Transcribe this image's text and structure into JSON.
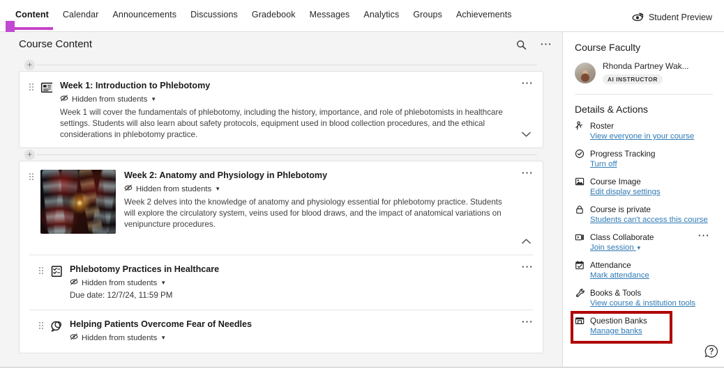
{
  "topnav": {
    "tabs": [
      {
        "label": "Content",
        "active": true
      },
      {
        "label": "Calendar",
        "active": false
      },
      {
        "label": "Announcements",
        "active": false
      },
      {
        "label": "Discussions",
        "active": false
      },
      {
        "label": "Gradebook",
        "active": false
      },
      {
        "label": "Messages",
        "active": false
      },
      {
        "label": "Analytics",
        "active": false
      },
      {
        "label": "Groups",
        "active": false
      },
      {
        "label": "Achievements",
        "active": false
      }
    ],
    "student_preview": "Student Preview",
    "accent_color": "#c644c6"
  },
  "main": {
    "title": "Course Content",
    "search_icon": "search-icon",
    "options_icon": "more-options-icon",
    "add_label": "+",
    "items": [
      {
        "icon": "module-document-icon",
        "title": "Week 1: Introduction to Phlebotomy",
        "visibility": "Hidden from students",
        "description": "Week 1 will cover the fundamentals of phlebotomy, including the history, importance, and role of phlebotomists in healthcare settings. Students will also learn about safety protocols, equipment used in blood collection procedures, and the ethical considerations in phlebotomy practice.",
        "chevron": "chevron-down",
        "thumbnail": false,
        "due": ""
      },
      {
        "icon": "module-document-icon",
        "title": "Week 2: Anatomy and Physiology in Phlebotomy",
        "visibility": "Hidden from students",
        "description": "Week 2 delves into the knowledge of anatomy and physiology essential for phlebotomy practice. Students will explore the circulatory system, veins used for blood draws, and the impact of anatomical variations on venipuncture procedures.",
        "chevron": "chevron-up",
        "thumbnail": true,
        "due": ""
      },
      {
        "icon": "test-assessment-icon",
        "title": "Phlebotomy Practices in Healthcare",
        "visibility": "Hidden from students",
        "description": "",
        "chevron": "",
        "thumbnail": false,
        "due": "Due date: 12/7/24, 11:59 PM"
      },
      {
        "icon": "discussion-icon",
        "title": "Helping Patients Overcome Fear of Needles",
        "visibility": "Hidden from students",
        "description": "",
        "chevron": "",
        "thumbnail": false,
        "due": ""
      }
    ]
  },
  "sidebar": {
    "faculty_title": "Course Faculty",
    "faculty": {
      "name": "Rhonda Partney Wak...",
      "badge": "AI INSTRUCTOR"
    },
    "details_title": "Details & Actions",
    "items": [
      {
        "icon": "roster-person-icon",
        "label": "Roster",
        "link": "View everyone in your course",
        "caret": false,
        "dots": false,
        "highlight": false
      },
      {
        "icon": "progress-check-icon",
        "label": "Progress Tracking",
        "link": "Turn off",
        "caret": false,
        "dots": false,
        "highlight": false
      },
      {
        "icon": "course-image-icon",
        "label": "Course Image",
        "link": "Edit display settings",
        "caret": false,
        "dots": false,
        "highlight": false
      },
      {
        "icon": "lock-icon",
        "label": "Course is private",
        "link": "Students can't access this course",
        "caret": false,
        "dots": false,
        "highlight": false
      },
      {
        "icon": "video-collaborate-icon",
        "label": "Class Collaborate",
        "link": "Join session",
        "caret": true,
        "dots": true,
        "highlight": false
      },
      {
        "icon": "attendance-calendar-icon",
        "label": "Attendance",
        "link": "Mark attendance",
        "caret": false,
        "dots": false,
        "highlight": false
      },
      {
        "icon": "tools-wrench-icon",
        "label": "Books & Tools",
        "link": "View course & institution tools",
        "caret": false,
        "dots": false,
        "highlight": false
      },
      {
        "icon": "question-bank-icon",
        "label": "Question Banks",
        "link": "Manage banks",
        "caret": false,
        "dots": false,
        "highlight": true
      }
    ],
    "highlight_color": "#b00000",
    "link_color": "#2f7ab5",
    "help_icon": "help-question-icon"
  }
}
